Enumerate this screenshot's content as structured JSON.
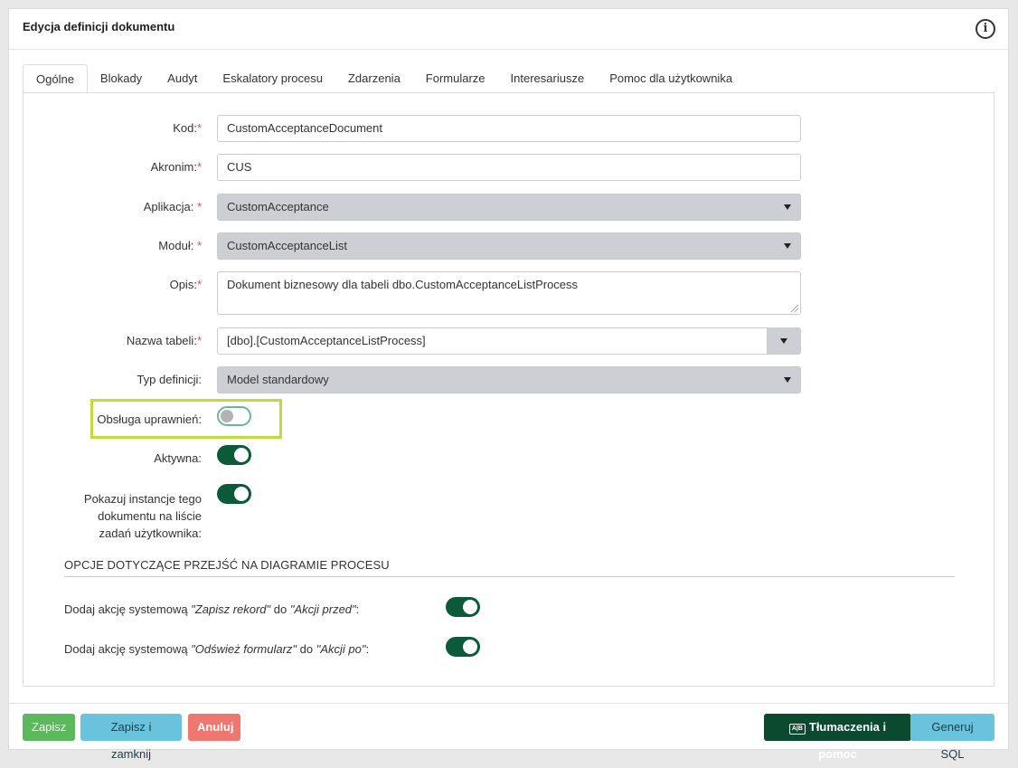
{
  "header": {
    "title": "Edycja definicji dokumentu",
    "info_icon": "i"
  },
  "tabs": [
    {
      "label": "Ogólne",
      "active": true
    },
    {
      "label": "Blokady"
    },
    {
      "label": "Audyt"
    },
    {
      "label": "Eskalatory procesu"
    },
    {
      "label": "Zdarzenia"
    },
    {
      "label": "Formularze"
    },
    {
      "label": "Interesariusze"
    },
    {
      "label": "Pomoc dla użytkownika"
    }
  ],
  "form": {
    "required_mark": "*",
    "kod": {
      "label": "Kod:",
      "value": "CustomAcceptanceDocument"
    },
    "akronim": {
      "label": "Akronim:",
      "value": "CUS"
    },
    "aplikacja": {
      "label": "Aplikacja: ",
      "value": "CustomAcceptance"
    },
    "modul": {
      "label": "Moduł: ",
      "value": "CustomAcceptanceList"
    },
    "opis": {
      "label": "Opis:",
      "value": "Dokument biznesowy dla tabeli dbo.CustomAcceptanceListProcess"
    },
    "nazwa_tabeli": {
      "label": "Nazwa tabeli:",
      "value": "[dbo].[CustomAcceptanceListProcess]"
    },
    "typ_definicji": {
      "label": "Typ definicji:",
      "value": "Model standardowy"
    },
    "obsluga_uprawnien": {
      "label": "Obsługa uprawnień:",
      "on": false
    },
    "aktywna": {
      "label": "Aktywna:",
      "on": true
    },
    "pokazuj": {
      "label_lines": [
        "Pokazuj instancje tego",
        "dokumentu na liście",
        "zadań użytkownika:"
      ],
      "on": true
    }
  },
  "options": {
    "section_title": "OPCJE DOTYCZĄCE PRZEJŚĆ NA DIAGRAMIE PROCESU",
    "opt1": {
      "prefix": "Dodaj akcję systemową ",
      "action": "\"Zapisz rekord\"",
      "mid": " do ",
      "target": "\"Akcji przed\"",
      "suffix": ":",
      "on": true
    },
    "opt2": {
      "prefix": "Dodaj akcję systemową ",
      "action": "\"Odśwież formularz\"",
      "mid": " do ",
      "target": "\"Akcji po\"",
      "suffix": ":",
      "on": true
    }
  },
  "footer": {
    "save": "Zapisz",
    "save_close": "Zapisz i zamknij",
    "cancel": "Anuluj",
    "translations_icon": "A|B",
    "translations": "Tłumaczenia i pomoc",
    "generate_sql": "Generuj SQL"
  },
  "colors": {
    "toggle_on": "#0b5a3a",
    "highlight": "#c0dc3c",
    "save": "#5cb85c",
    "cancel": "#f0776f",
    "info": "#6ac3dc"
  }
}
